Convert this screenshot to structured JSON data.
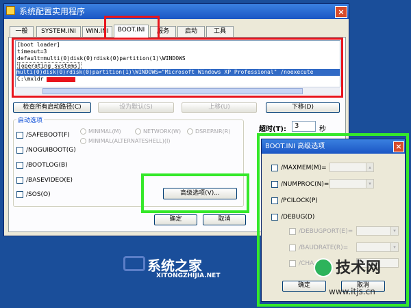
{
  "window": {
    "title": "系统配置实用程序",
    "close": "×"
  },
  "tabs": [
    {
      "label": "一般"
    },
    {
      "label": "SYSTEM.INI"
    },
    {
      "label": "WIN.INI"
    },
    {
      "label": "BOOT.INI"
    },
    {
      "label": "服务"
    },
    {
      "label": "启动"
    },
    {
      "label": "工具"
    }
  ],
  "boot_ini": {
    "lines": [
      "[boot loader]",
      "timeout=3",
      "default=multi(0)disk(0)rdisk(0)partition(1)\\WINDOWS",
      "[operating systems]",
      "multi(0)disk(0)rdisk(0)partition(1)\\WINDOWS=\"Microsoft Windows XP Professional\" /noexecute",
      "C:\\mxldr"
    ]
  },
  "buttons": {
    "check_paths": "检查所有启动路径(C)",
    "set_default": "设为默认(S)",
    "move_up": "上移(U)",
    "move_down": "下移(D)",
    "advanced": "高级选项(V)...",
    "ok": "确定",
    "cancel": "取消"
  },
  "timeout": {
    "label": "超时(T):",
    "value": "3",
    "unit": "秒"
  },
  "boot_options": {
    "group_label": "启动选项",
    "checks": [
      "/SAFEBOOT(F)",
      "/NOGUIBOOT(G)",
      "/BOOTLOG(B)",
      "/BASEVIDEO(E)",
      "/SOS(O)"
    ],
    "radios": {
      "minimal": "MINIMAL(M)",
      "network": "NETWORK(W)",
      "dsrepair": "DSREPAIR(R)",
      "alternate": "MINIMAL(ALTERNATESHELL)(I)"
    }
  },
  "advanced_dialog": {
    "title": "BOOT.INI 高级选项",
    "close": "×",
    "maxmem": "/MAXMEM(M)=",
    "numproc": "/NUMPROC(N)=",
    "pcilock": "/PCILOCK(P)",
    "debug": "/DEBUG(D)",
    "debugport": "/DEBUGPORT(E)=",
    "baudrate": "/BAUDRATE(R)=",
    "channel": "/CHA",
    "ok": "确定",
    "cancel": "取消"
  },
  "watermarks": {
    "left_cn": "系统之家",
    "left_url": "XITONGZHIJIA.NET",
    "right_cn": "技术网",
    "right_url": "www.itjs.cn"
  },
  "colors": {
    "highlight_red": "#e8141c",
    "highlight_green": "#35e82a",
    "title_blue": "#1b56c4",
    "desktop_blue": "#1a4e9a"
  }
}
